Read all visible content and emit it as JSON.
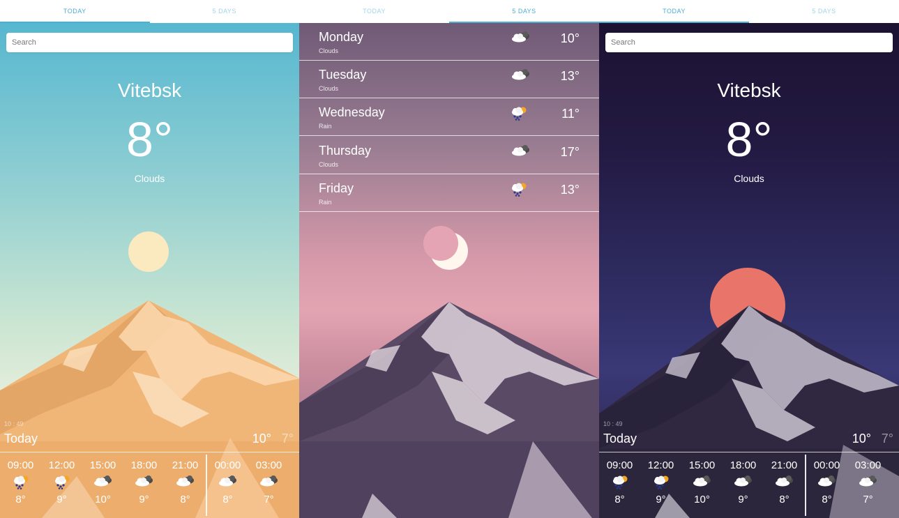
{
  "screens": {
    "today_day": {
      "tabs": {
        "today": "TODAY",
        "five_days": "5 DAYS"
      },
      "search_placeholder": "Search",
      "city": "Vitebsk",
      "temperature": "8°",
      "condition": "Clouds",
      "time": "10 : 49",
      "today_label": "Today",
      "high": "10°",
      "low": "7°",
      "hourly": [
        {
          "hour": "09:00",
          "icon": "rain-sun-icon",
          "temp": "8°"
        },
        {
          "hour": "12:00",
          "icon": "rain-sun-icon",
          "temp": "9°"
        },
        {
          "hour": "15:00",
          "icon": "cloud-icon",
          "temp": "10°"
        },
        {
          "hour": "18:00",
          "icon": "cloud-icon",
          "temp": "9°"
        },
        {
          "hour": "21:00",
          "icon": "cloud-icon",
          "temp": "8°"
        },
        {
          "hour": "00:00",
          "icon": "cloud-icon",
          "temp": "8°"
        },
        {
          "hour": "03:00",
          "icon": "cloud-icon",
          "temp": "7°"
        }
      ]
    },
    "five_days": {
      "tabs": {
        "today": "TODAY",
        "five_days": "5 DAYS"
      },
      "days": [
        {
          "day": "Monday",
          "condition": "Clouds",
          "icon": "cloud-icon",
          "temp": "10°"
        },
        {
          "day": "Tuesday",
          "condition": "Clouds",
          "icon": "cloud-icon",
          "temp": "13°"
        },
        {
          "day": "Wednesday",
          "condition": "Rain",
          "icon": "rain-sun-icon",
          "temp": "11°"
        },
        {
          "day": "Thursday",
          "condition": "Clouds",
          "icon": "cloud-icon",
          "temp": "17°"
        },
        {
          "day": "Friday",
          "condition": "Rain",
          "icon": "rain-sun-icon",
          "temp": "13°"
        }
      ]
    },
    "today_night": {
      "tabs": {
        "today": "TODAY",
        "five_days": "5 DAYS"
      },
      "search_placeholder": "Search",
      "city": "Vitebsk",
      "temperature": "8°",
      "condition": "Clouds",
      "time": "10 : 49",
      "today_label": "Today",
      "high": "10°",
      "low": "7°",
      "hourly": [
        {
          "hour": "09:00",
          "icon": "rain-sun-icon",
          "temp": "8°"
        },
        {
          "hour": "12:00",
          "icon": "rain-sun-icon",
          "temp": "9°"
        },
        {
          "hour": "15:00",
          "icon": "cloud-icon",
          "temp": "10°"
        },
        {
          "hour": "18:00",
          "icon": "cloud-icon",
          "temp": "9°"
        },
        {
          "hour": "21:00",
          "icon": "cloud-icon",
          "temp": "8°"
        },
        {
          "hour": "00:00",
          "icon": "cloud-icon",
          "temp": "8°"
        },
        {
          "hour": "03:00",
          "icon": "cloud-icon",
          "temp": "7°"
        }
      ]
    }
  },
  "colors": {
    "tab_active": "#4aaed6",
    "tab_inactive": "#9fd4ea",
    "sun_day": "#fbe9bf",
    "moon": "#fff6ee",
    "sun_night": "#e8746a"
  }
}
